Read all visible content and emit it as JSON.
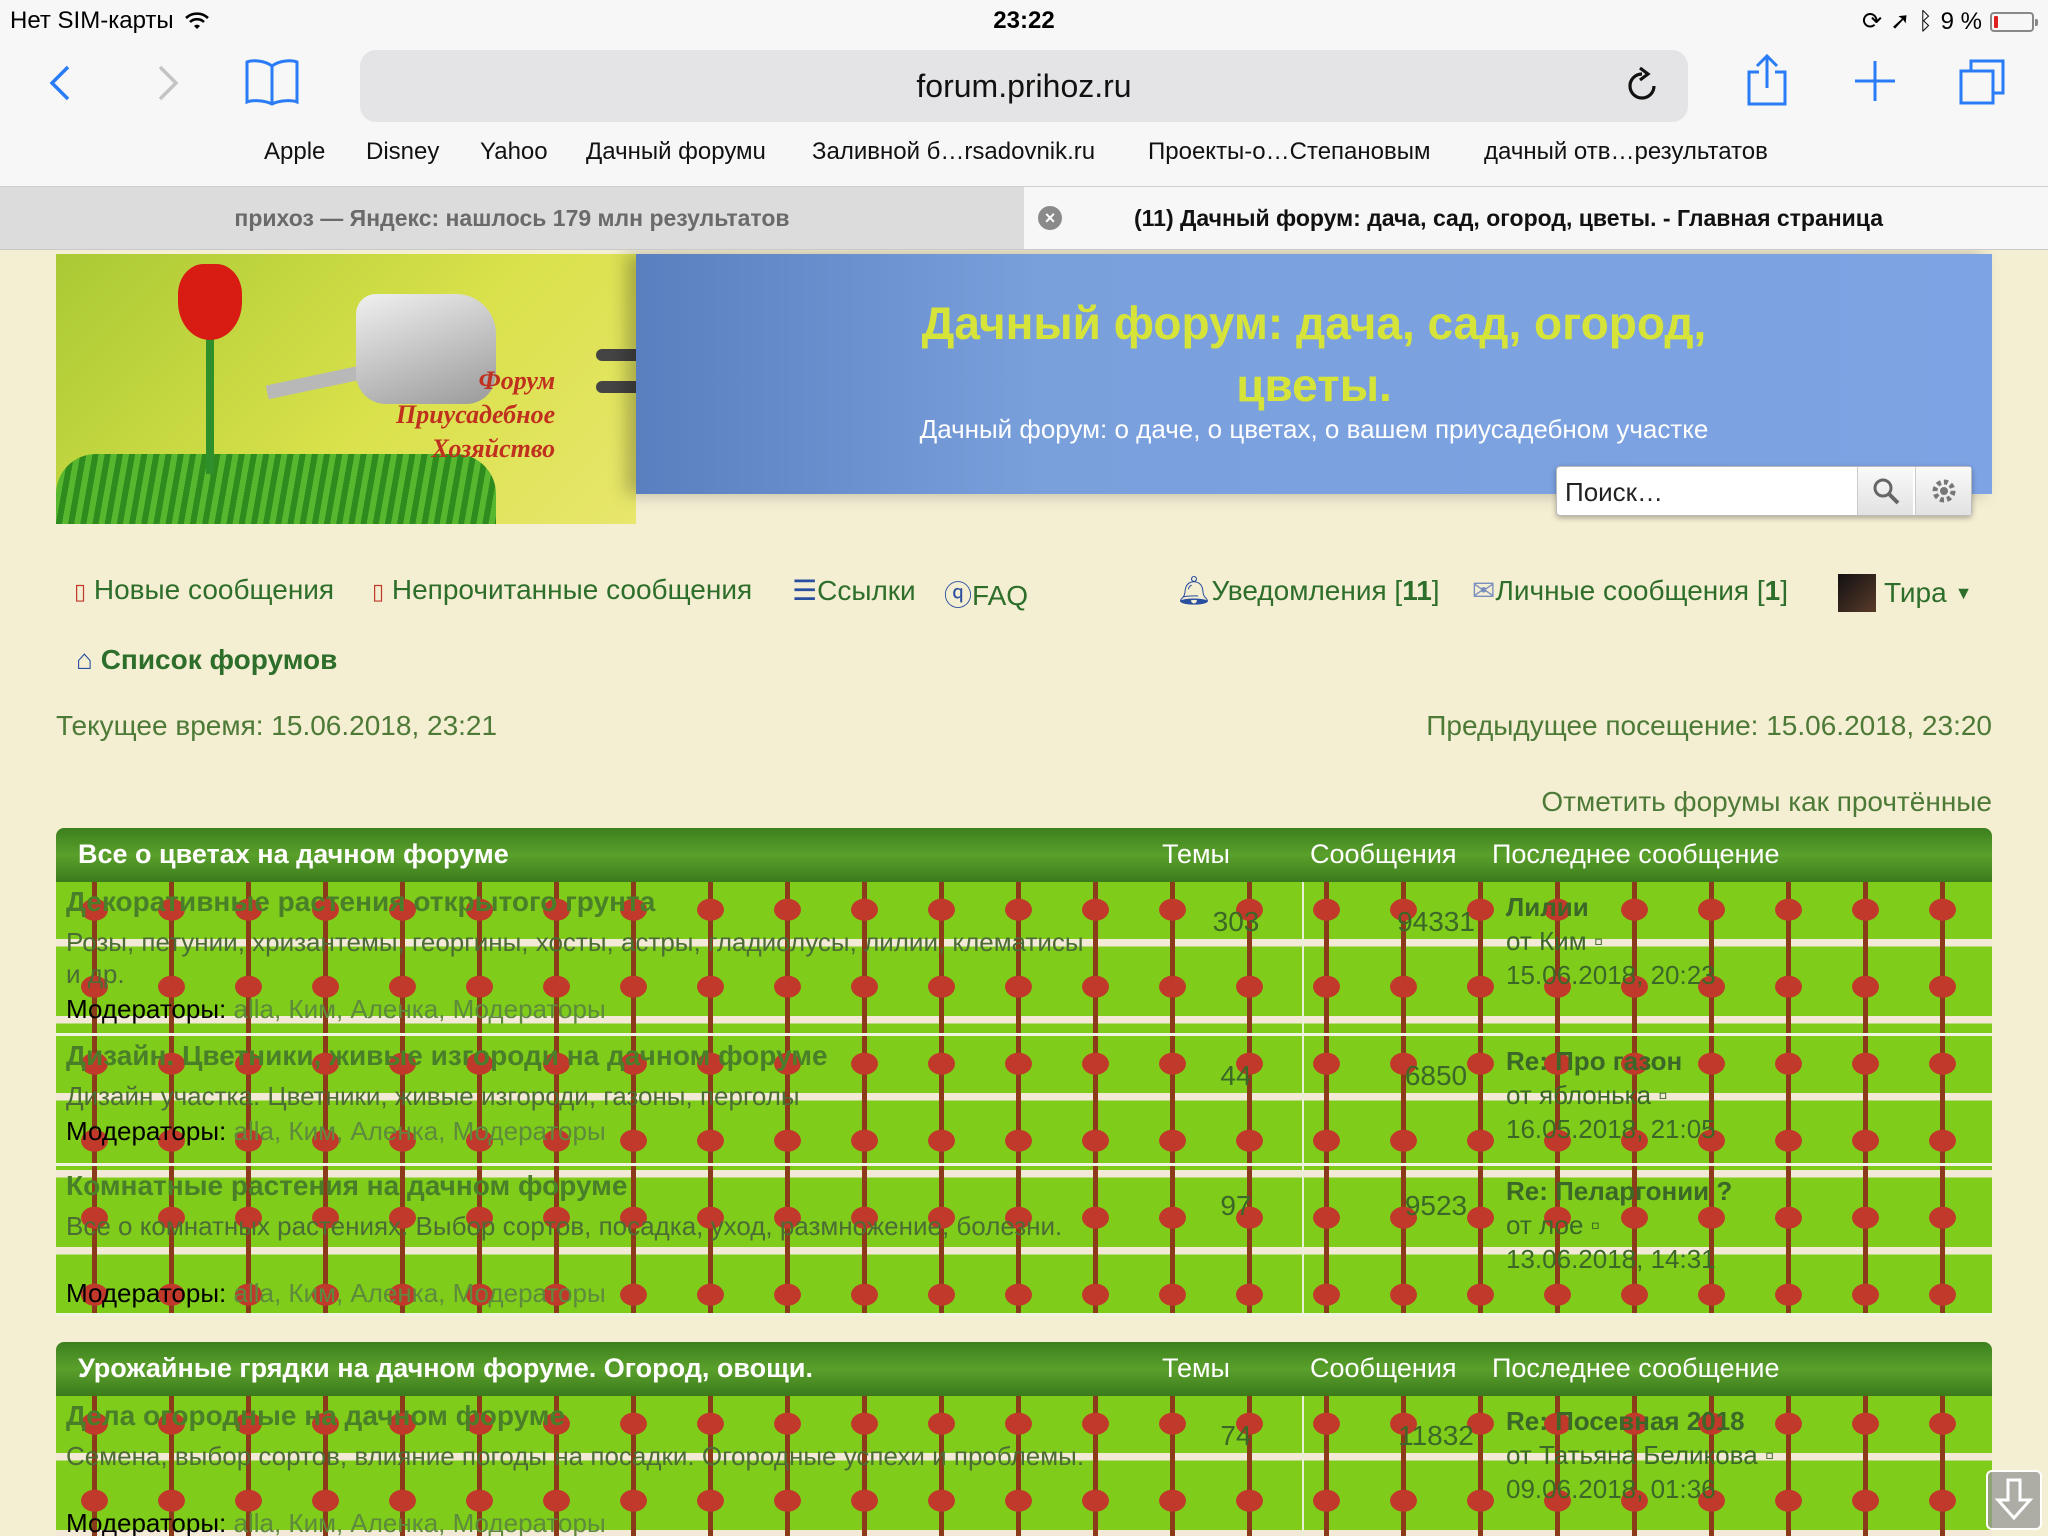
{
  "status": {
    "carrier": "Нет SIM-карты",
    "time": "23:22",
    "battery": "9 %",
    "battery_level": 0.09
  },
  "browser": {
    "url": "forum.prihoz.ru",
    "bookmarks": [
      "Apple",
      "Disney",
      "Yahoo",
      "Дачный форумu",
      "Заливной б…rsadovnik.ru",
      "Проекты-о…Степановым",
      "дачный отв…результатов"
    ],
    "tabs": [
      {
        "label": "прихоз — Яндекс: нашлось 179 млн результатов"
      },
      {
        "label": "(11) Дачный форум: дача, сад, огород, цветы. - Главная страница"
      }
    ]
  },
  "banner": {
    "logo_text_1": "Форум",
    "logo_text_2": "Приусадебное",
    "logo_text_3": "Хозяйство",
    "title_line1": "Дачный форум: дача, сад, огород,",
    "title_line2": "цветы.",
    "subtitle": "Дачный форум: о даче, о цветах, о вашем приусадебном участке"
  },
  "search": {
    "placeholder": "Поиск…"
  },
  "nav": {
    "new_posts": "Новые сообщения",
    "unread_posts": "Непрочитанные сообщения",
    "links": "Ссылки",
    "faq": "FAQ",
    "notifications": "Уведомления",
    "notifications_count": "11",
    "messages": "Личные сообщения",
    "messages_count": "1",
    "user": "Тира",
    "forum_list": "Список форумов"
  },
  "times": {
    "current": "Текущее время: 15.06.2018, 23:21",
    "previous": "Предыдущее посещение: 15.06.2018, 23:20",
    "mark_read": "Отметить форумы как прочтённые"
  },
  "columns": {
    "topics": "Темы",
    "posts": "Сообщения",
    "last": "Последнее сообщение"
  },
  "categories": [
    {
      "title": "Все о цветах на дачном форуме",
      "forums": [
        {
          "name": "Декоративные растения открытого грунта",
          "desc": "Розы, петунии, хризантемы, георгины, хосты, астры, гладиолусы, лилии, клематисы и др.",
          "mods_label": "Модераторы:",
          "mods": "alla, Ким, Аленка, Модераторы",
          "topics": "303",
          "posts": "94331",
          "last_title": "Лилии",
          "last_by": "от Ким",
          "last_date": "15.06.2018, 20:23"
        },
        {
          "name": "Дизайн. Цветники, живые изгороди на дачном форуме",
          "desc": "Дизайн участка. Цветники, живые изгороди, газоны, перголы",
          "mods_label": "Модераторы:",
          "mods": "alla, Ким, Аленка, Модераторы",
          "topics": "44",
          "posts": "6850",
          "last_title": "Re: Про газон",
          "last_by": "от яблонька",
          "last_date": "16.05.2018, 21:05"
        },
        {
          "name": "Комнатные растения на дачном форуме",
          "desc": "Все о комнатных растениях. Выбор сортов, посадка, уход, размножение, болезни.",
          "mods_label": "Модераторы:",
          "mods": "alla, Ким, Аленка, Модераторы",
          "topics": "97",
          "posts": "9523",
          "last_title": "Re: Пеларгонии ?",
          "last_by": "от лое",
          "last_date": "13.06.2018, 14:31"
        }
      ]
    },
    {
      "title": "Урожайные грядки на дачном форуме. Огород, овощи.",
      "forums": [
        {
          "name": "Дела огородные на дачном форуме",
          "desc": "Семена, выбор сортов, влияние погоды на посадки. Огородные успехи и проблемы.",
          "mods_label": "Модераторы:",
          "mods": "alla, Ким, Аленка, Модераторы",
          "topics": "74",
          "posts": "11832",
          "last_title": "Re: Посевная 2018",
          "last_by": "от Татьяна Беликова",
          "last_date": "09.06.2018, 01:36"
        }
      ]
    }
  ],
  "colors": {
    "accent": "#2a7cf6",
    "forum_green": "#2e6e2b",
    "header_green": "#4a8f24",
    "banner_yellow": "#d6e43a"
  }
}
